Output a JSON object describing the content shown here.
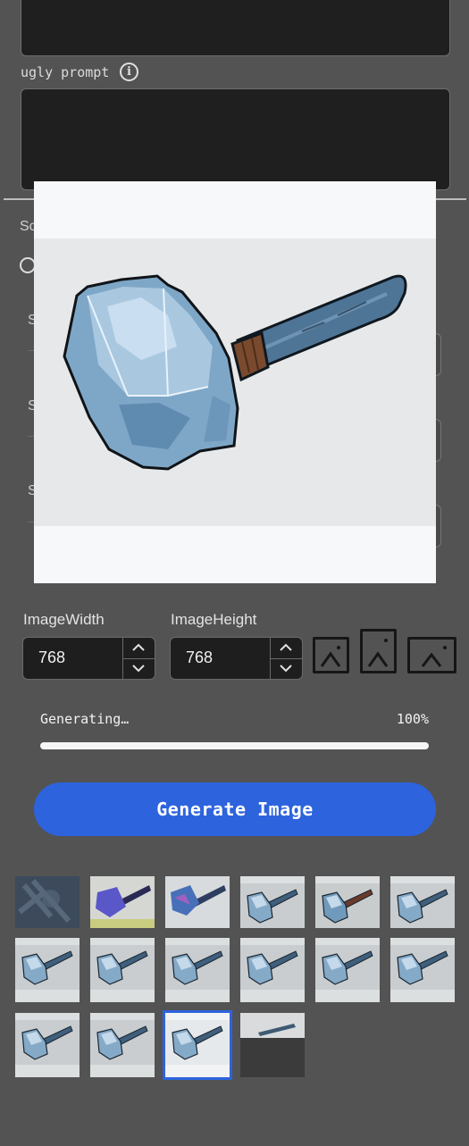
{
  "prompt_section": {
    "ugly_prompt_label": "ugly prompt",
    "info_icon": "info-icon"
  },
  "background_fragments": {
    "section_label": "Sc",
    "row_labels": [
      "S",
      "S",
      "S"
    ]
  },
  "dimensions": {
    "width_label": "ImageWidth",
    "width_value": "768",
    "height_label": "ImageHeight",
    "height_value": "768",
    "aspect_icons": [
      "square-image-icon",
      "portrait-image-icon",
      "landscape-image-icon"
    ]
  },
  "progress": {
    "label": "Generating…",
    "percent_text": "100%",
    "value": 1.0
  },
  "generate_button": "Generate Image",
  "gallery": {
    "thumbnails": [
      {
        "style": "noise"
      },
      {
        "style": "early-purple"
      },
      {
        "style": "early-mixed"
      },
      {
        "style": "hammer"
      },
      {
        "style": "hammer-red"
      },
      {
        "style": "hammer"
      },
      {
        "style": "hammer"
      },
      {
        "style": "hammer"
      },
      {
        "style": "hammer"
      },
      {
        "style": "hammer"
      },
      {
        "style": "hammer"
      },
      {
        "style": "hammer"
      },
      {
        "style": "hammer"
      },
      {
        "style": "hammer"
      },
      {
        "style": "hammer",
        "selected": true
      },
      {
        "style": "partial"
      }
    ]
  },
  "colors": {
    "accent": "#2d63dd",
    "background": "#535353",
    "input_bg": "#1e1e1e"
  }
}
